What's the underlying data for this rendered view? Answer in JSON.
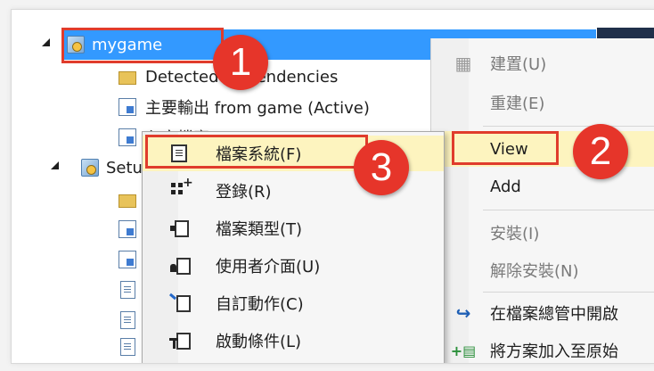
{
  "tree": {
    "items": [
      {
        "label": "mygame"
      },
      {
        "label": "Detected Dependencies"
      },
      {
        "label": "主要輸出 from game (Active)"
      },
      {
        "label": "內容檔案 from game"
      },
      {
        "label": "Setup"
      }
    ]
  },
  "context_menu": {
    "items": [
      {
        "label": "建置(U)"
      },
      {
        "label": "重建(E)"
      },
      {
        "label": "View"
      },
      {
        "label": "Add"
      },
      {
        "label": "安裝(I)"
      },
      {
        "label": "解除安裝(N)"
      },
      {
        "label": "在檔案總管中開啟"
      },
      {
        "label": "將方案加入至原始"
      }
    ]
  },
  "view_submenu": {
    "items": [
      {
        "label": "檔案系統(F)"
      },
      {
        "label": "登錄(R)"
      },
      {
        "label": "檔案類型(T)"
      },
      {
        "label": "使用者介面(U)"
      },
      {
        "label": "自訂動作(C)"
      },
      {
        "label": "啟動條件(L)"
      }
    ]
  },
  "annotations": {
    "step1": "1",
    "step2": "2",
    "step3": "3"
  },
  "colors": {
    "selection": "#3399ff",
    "menu_hover": "#fdf4bf",
    "annotation_red": "#e03c2c"
  }
}
